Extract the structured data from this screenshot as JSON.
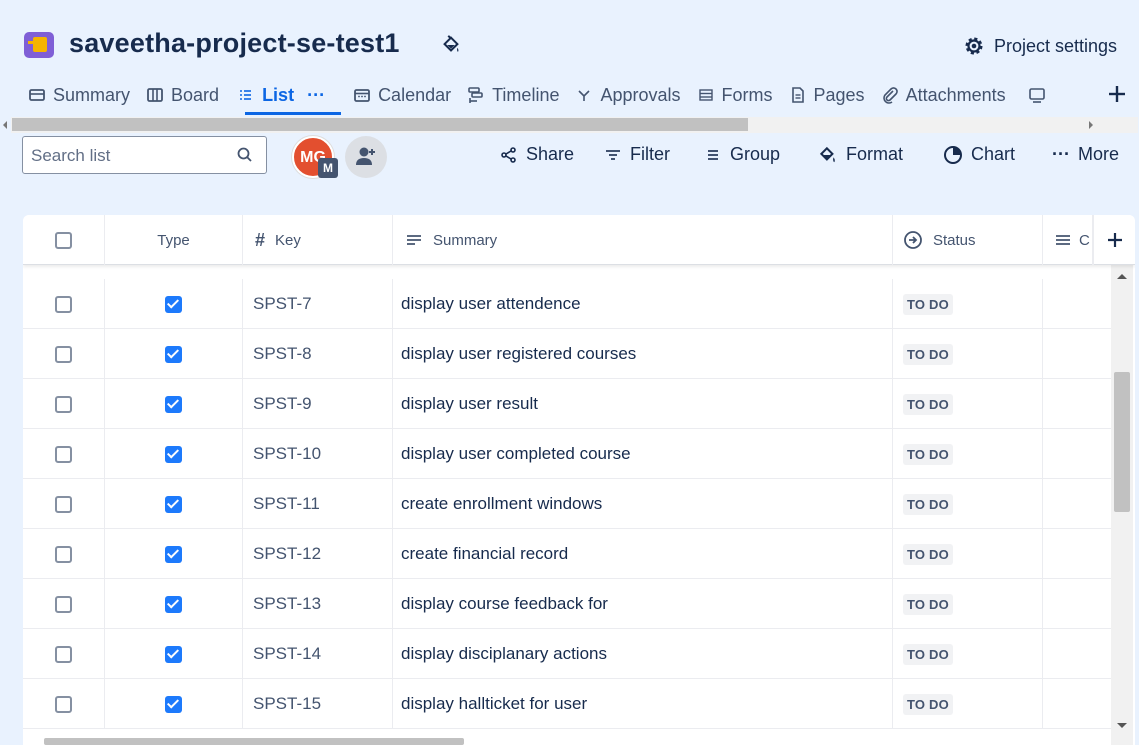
{
  "project": {
    "title": "saveetha-project-se-test1",
    "settings_label": "Project settings"
  },
  "tabs": [
    {
      "label": "Summary",
      "icon": "summary-icon"
    },
    {
      "label": "Board",
      "icon": "board-icon"
    },
    {
      "label": "List",
      "icon": "list-icon",
      "active": true,
      "more": "···"
    },
    {
      "label": "Calendar",
      "icon": "calendar-icon"
    },
    {
      "label": "Timeline",
      "icon": "timeline-icon"
    },
    {
      "label": "Approvals",
      "icon": "approvals-icon"
    },
    {
      "label": "Forms",
      "icon": "forms-icon"
    },
    {
      "label": "Pages",
      "icon": "pages-icon"
    },
    {
      "label": "Attachments",
      "icon": "attachments-icon"
    }
  ],
  "toolbar": {
    "search_placeholder": "Search list",
    "avatar_initials": "MG",
    "avatar_sub": "M",
    "share": "Share",
    "filter": "Filter",
    "group": "Group",
    "format": "Format",
    "chart": "Chart",
    "more": "More"
  },
  "table": {
    "headers": {
      "type": "Type",
      "key": "Key",
      "summary": "Summary",
      "status": "Status",
      "extra": "C"
    },
    "rows": [
      {
        "key": "SPST-7",
        "summary": "display user attendence",
        "status": "TO DO"
      },
      {
        "key": "SPST-8",
        "summary": "display user registered courses",
        "status": "TO DO"
      },
      {
        "key": "SPST-9",
        "summary": "display user result",
        "status": "TO DO"
      },
      {
        "key": "SPST-10",
        "summary": "display user completed course",
        "status": "TO DO"
      },
      {
        "key": "SPST-11",
        "summary": "create enrollment windows",
        "status": "TO DO"
      },
      {
        "key": "SPST-12",
        "summary": "create financial record",
        "status": "TO DO"
      },
      {
        "key": "SPST-13",
        "summary": "display course feedback for",
        "status": "TO DO"
      },
      {
        "key": "SPST-14",
        "summary": "display disciplanary actions",
        "status": "TO DO"
      },
      {
        "key": "SPST-15",
        "summary": "display hallticket for user",
        "status": "TO DO"
      }
    ]
  },
  "colors": {
    "accent": "#0c66e4",
    "background": "#e9f2fe",
    "avatar": "#e34f2f"
  }
}
